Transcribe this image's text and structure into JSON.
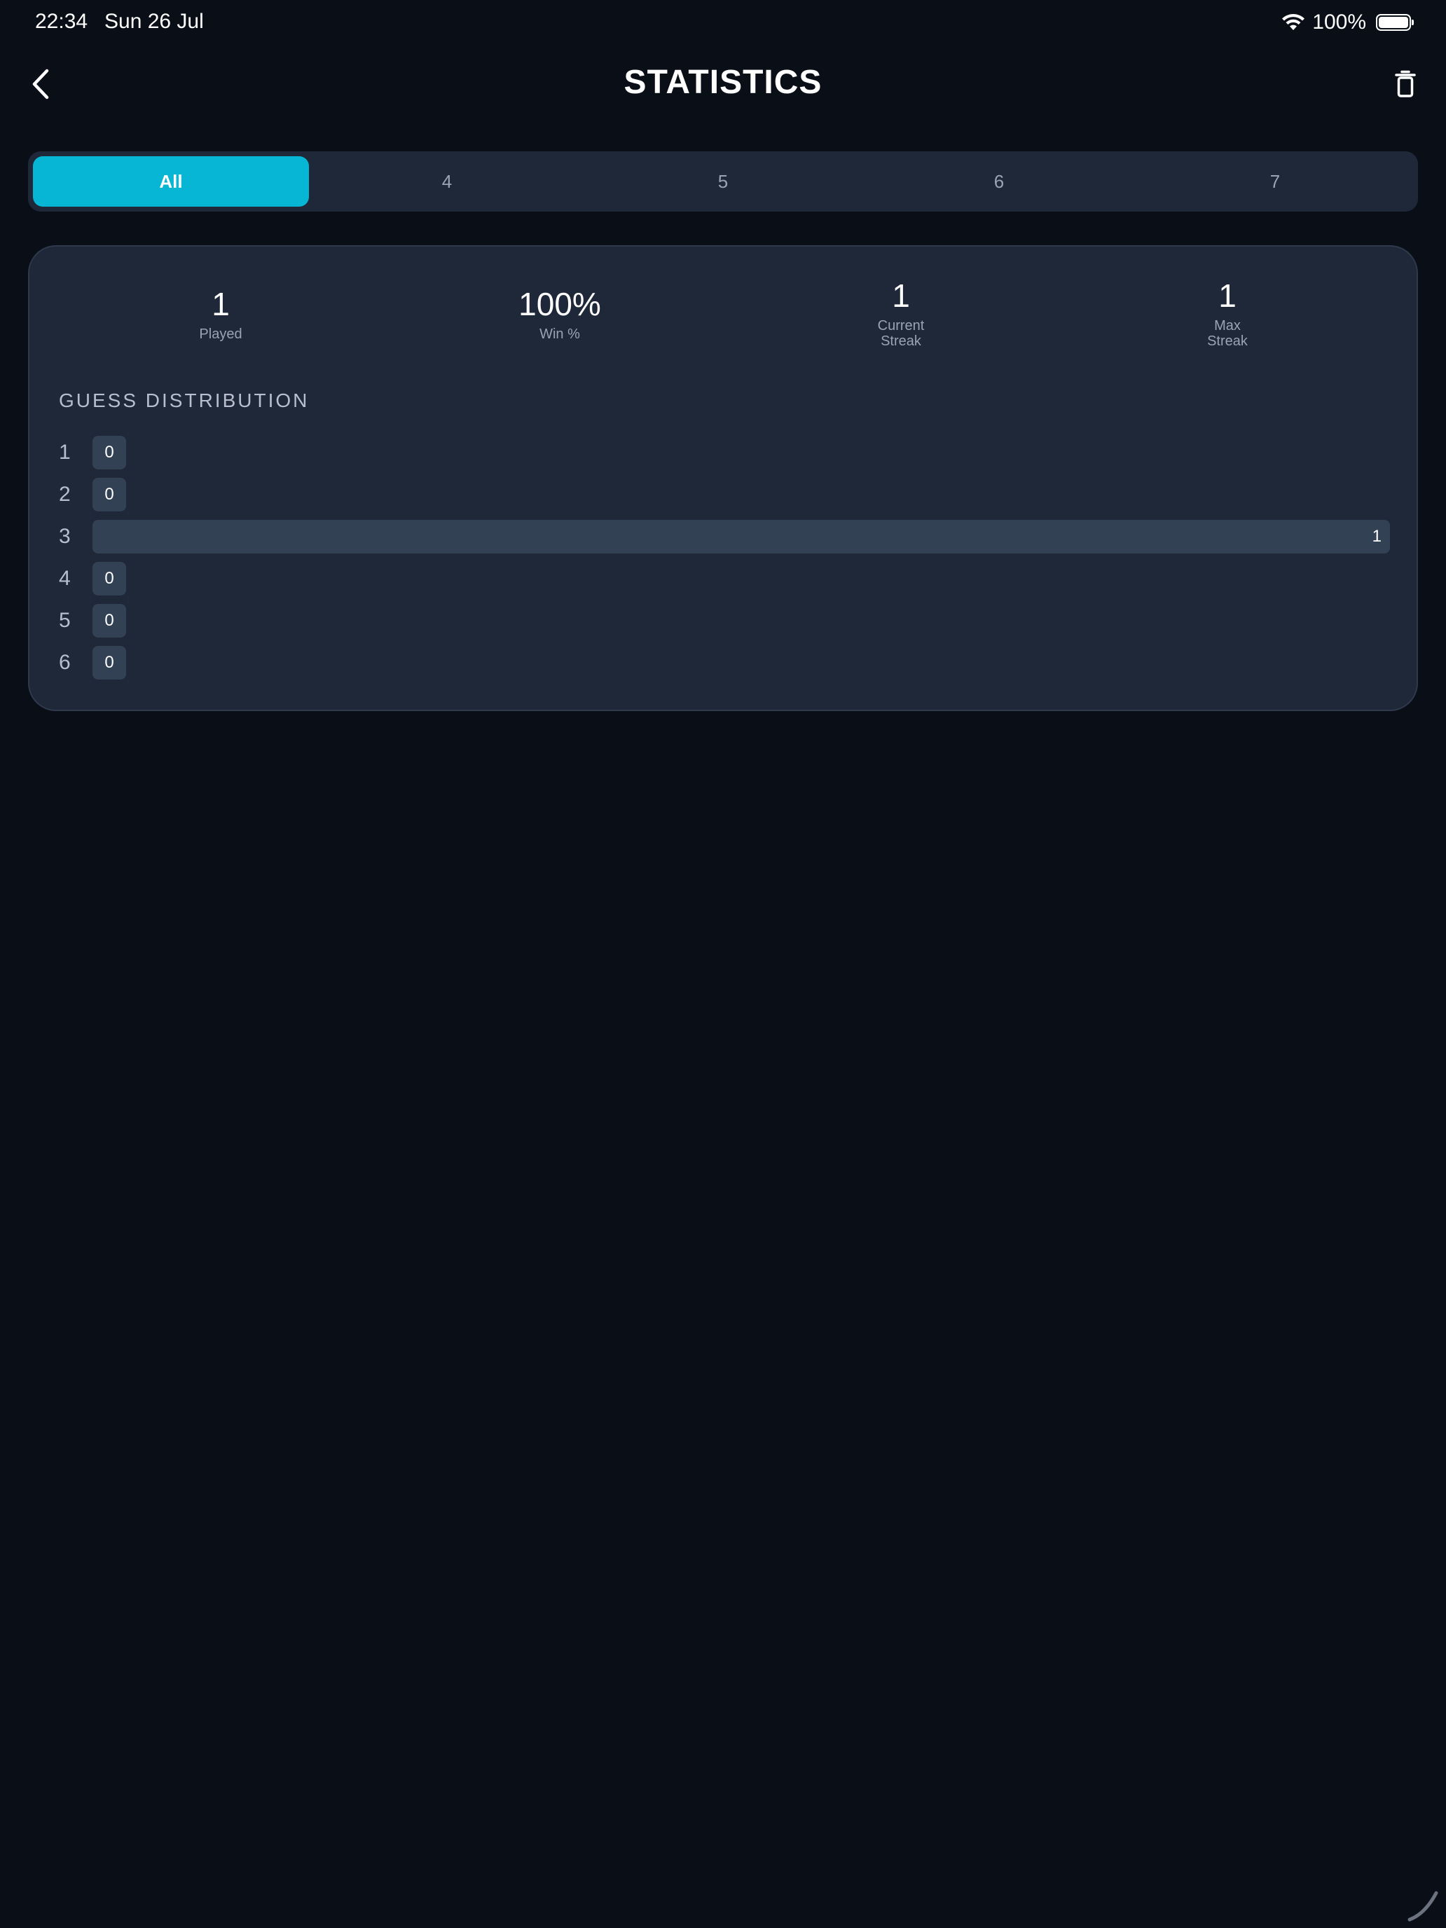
{
  "status_bar": {
    "time": "22:34",
    "date": "Sun 26 Jul",
    "battery": "100%",
    "icons": [
      "wifi-icon",
      "battery-icon"
    ]
  },
  "header": {
    "title": "STATISTICS",
    "back_icon": "chevron-left-icon",
    "delete_icon": "trash-icon"
  },
  "tabs": [
    {
      "label": "All",
      "active": true
    },
    {
      "label": "4",
      "active": false
    },
    {
      "label": "5",
      "active": false
    },
    {
      "label": "6",
      "active": false
    },
    {
      "label": "7",
      "active": false
    }
  ],
  "stats": [
    {
      "value": "1",
      "label": "Played"
    },
    {
      "value": "100%",
      "label": "Win %"
    },
    {
      "value": "1",
      "label": "Current\nStreak"
    },
    {
      "value": "1",
      "label": "Max\nStreak"
    }
  ],
  "distribution": {
    "title": "GUESS DISTRIBUTION",
    "rows": [
      {
        "guess": "1",
        "count": 0
      },
      {
        "guess": "2",
        "count": 0
      },
      {
        "guess": "3",
        "count": 1
      },
      {
        "guess": "4",
        "count": 0
      },
      {
        "guess": "5",
        "count": 0
      },
      {
        "guess": "6",
        "count": 0
      }
    ]
  },
  "colors": {
    "background": "#0a0e17",
    "card": "#1e2838",
    "accent": "#06b6d4",
    "bar": "#334155",
    "muted_text": "#9aa3b2"
  }
}
